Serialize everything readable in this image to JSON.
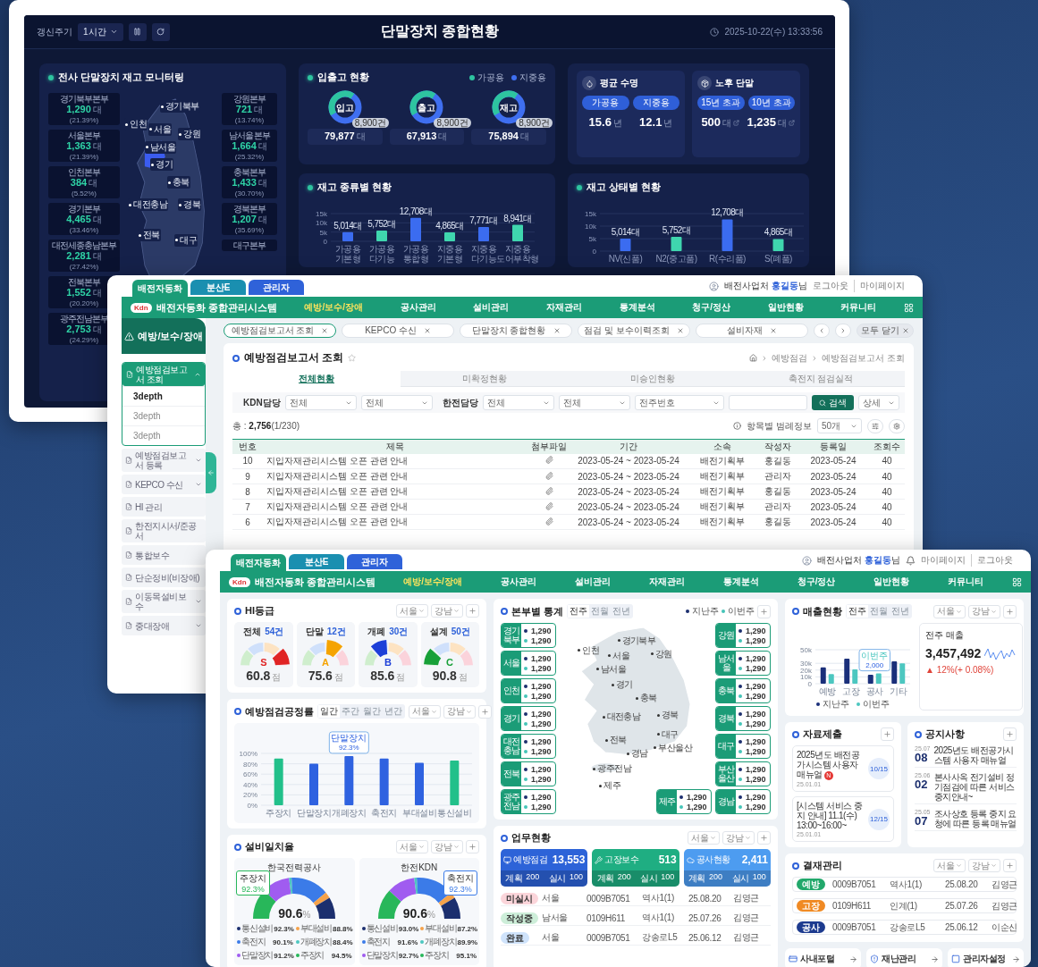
{
  "dashboard_window": {
    "refresh_label": "갱신주기",
    "refresh_interval": "1시간",
    "title": "단말장치 종합현황",
    "datetime": "2025-10-22(수) 13:33:56",
    "inventory_monitor": {
      "title": "전사 단말장치 재고 모니터링",
      "left_offices": [
        {
          "name": "경기북부본부",
          "value": "1,290",
          "unit": "대",
          "share": "(21.39%)"
        },
        {
          "name": "서울본부",
          "value": "1,363",
          "unit": "대",
          "share": "(21.39%)"
        },
        {
          "name": "인천본부",
          "value": "384",
          "unit": "대",
          "share": "(5.52%)"
        },
        {
          "name": "경기본부",
          "value": "4,465",
          "unit": "대",
          "share": "(33.46%)"
        },
        {
          "name": "대전세종충남본부",
          "value": "2,281",
          "unit": "대",
          "share": "(27.42%)"
        },
        {
          "name": "전북본부",
          "value": "1,552",
          "unit": "대",
          "share": "(20.20%)"
        },
        {
          "name": "광주전남본부",
          "value": "2,753",
          "unit": "대",
          "share": "(24.29%)"
        }
      ],
      "right_offices": [
        {
          "name": "강원본부",
          "value": "721",
          "unit": "대",
          "share": "(13.74%)"
        },
        {
          "name": "남서울본부",
          "value": "1,664",
          "unit": "대",
          "share": "(25.32%)"
        },
        {
          "name": "충북본부",
          "value": "1,433",
          "unit": "대",
          "share": "(30.70%)"
        },
        {
          "name": "경북본부",
          "value": "1,207",
          "unit": "대",
          "share": "(35.69%)"
        },
        {
          "name": "대구본부"
        }
      ],
      "map_labels": [
        "경기북부",
        "인천",
        "서울",
        "남서울",
        "경기",
        "강원",
        "충북",
        "대전충남",
        "경북",
        "전북",
        "대구"
      ]
    },
    "in_out": {
      "title": "입출고 현황",
      "legend": [
        {
          "label": "가공용",
          "color": "#2ec4a0"
        },
        {
          "label": "지중용",
          "color": "#3f6ff0"
        }
      ],
      "donuts": [
        {
          "label": "입고",
          "badge": "8,900건",
          "total": "79,877",
          "unit": "대"
        },
        {
          "label": "출고",
          "badge": "8,900건",
          "total": "67,913",
          "unit": "대"
        },
        {
          "label": "재고",
          "badge": "8,900건",
          "total": "75,894",
          "unit": "대"
        }
      ]
    },
    "average_life": {
      "title": "평균 수명",
      "items": [
        {
          "tag": "가공용",
          "value": "15.6",
          "unit": "년"
        },
        {
          "tag": "지중용",
          "value": "12.1",
          "unit": "년"
        }
      ]
    },
    "old_terminals": {
      "title": "노후 단말",
      "items": [
        {
          "tag": "15년 초과",
          "value": "500",
          "unit": "대"
        },
        {
          "tag": "10년 초과",
          "value": "1,235",
          "unit": "대"
        }
      ]
    },
    "type_chart": {
      "title": "재고 종류별 현황",
      "chart_data": {
        "type": "bar",
        "categories": [
          "가공용 기본형",
          "가공용 다기능",
          "가공용 통합형",
          "지중용 기본형",
          "지중용 다기능",
          "지중용 도어부착형"
        ],
        "series": [
          {
            "color": "#3b6cf0",
            "values": [
              5014,
              null,
              12708,
              null,
              7771,
              null
            ]
          },
          {
            "color": "#3fd6ae",
            "values": [
              null,
              5752,
              null,
              4865,
              null,
              8941
            ]
          }
        ],
        "ylim": [
          0,
          15000
        ],
        "grid": true,
        "yticks": [
          {
            "value": 0,
            "label": "0"
          },
          {
            "value": 5000,
            "label": "5k"
          },
          {
            "value": 10000,
            "label": "10k"
          },
          {
            "value": 15000,
            "label": "15k"
          }
        ],
        "value_labels": [
          "5,014대",
          "5,752대",
          "12,708대",
          "4,865대",
          "7,771대",
          "8,941대"
        ]
      }
    },
    "state_chart": {
      "title": "재고 상태별 현황",
      "chart_data": {
        "type": "bar",
        "categories": [
          "NV(신품)",
          "N2(중고품)",
          "R(수리품)",
          "S(폐품)"
        ],
        "series": [
          {
            "color": "#3b6cf0",
            "values": [
              5014,
              null,
              12708,
              null
            ]
          },
          {
            "color": "#3fd6ae",
            "values": [
              null,
              5752,
              null,
              4865
            ]
          }
        ],
        "ylim": [
          0,
          15000
        ],
        "grid": true,
        "yticks": [
          {
            "value": 0,
            "label": "0"
          },
          {
            "value": 5000,
            "label": "5k"
          },
          {
            "value": 10000,
            "label": "10k"
          },
          {
            "value": 15000,
            "label": "15k"
          }
        ],
        "value_labels": [
          "5,014대",
          "5,752대",
          "12,708대",
          "4,865대"
        ]
      }
    }
  },
  "report_window": {
    "system_tabs": [
      {
        "label": "배전자동화",
        "selected": true,
        "color": "#1b9c77"
      },
      {
        "label": "분산E",
        "selected": false,
        "color": "#1a8fb0"
      },
      {
        "label": "관리자",
        "selected": false,
        "color": "#2f62d9"
      }
    ],
    "user": "배전사업처 **홍길동**님",
    "links": [
      "로그아웃",
      "마이페이지"
    ],
    "brand": {
      "logo": "Kdn",
      "name": "배전자동화 종합관리시스템"
    },
    "menu": [
      {
        "label": "예방/보수/장애",
        "selected": true
      },
      {
        "label": "공사관리",
        "selected": false
      },
      {
        "label": "설비관리",
        "selected": false
      },
      {
        "label": "자재관리",
        "selected": false
      },
      {
        "label": "통계분석",
        "selected": false
      },
      {
        "label": "청구/정산",
        "selected": false
      },
      {
        "label": "일반현황",
        "selected": false
      },
      {
        "label": "커뮤니티",
        "selected": false
      }
    ],
    "sidebar": {
      "title": "예방/보수/장애",
      "items": [
        {
          "label": "예방점검보고서 조회",
          "expandable": true,
          "expanded": true,
          "selected": true,
          "children": [
            {
              "label": "3depth",
              "selected": true
            },
            {
              "label": "3depth",
              "selected": false
            },
            {
              "label": "3depth",
              "selected": false
            }
          ]
        },
        {
          "label": "예방점검보고서 등록",
          "expandable": true,
          "expanded": false,
          "selected": false
        },
        {
          "label": "KEPCO 수신",
          "expandable": true,
          "expanded": false,
          "selected": false
        },
        {
          "label": "HI 관리",
          "expandable": false,
          "expanded": false,
          "selected": false
        },
        {
          "label": "한전지시서/준공서",
          "expandable": false,
          "expanded": false,
          "selected": false
        },
        {
          "label": "통합보수",
          "expandable": false,
          "expanded": false,
          "selected": false
        },
        {
          "label": "단순정비(비장애)",
          "expandable": false,
          "expanded": false,
          "selected": false
        },
        {
          "label": "이동목설비보수",
          "expandable": true,
          "expanded": false,
          "selected": false
        },
        {
          "label": "중대장애",
          "expandable": true,
          "expanded": false,
          "selected": false
        }
      ]
    },
    "page_tabs": [
      {
        "label": "예방점검보고서 조회",
        "selected": true
      },
      {
        "label": "KEPCO 수신",
        "selected": false
      },
      {
        "label": "단말장치 종합현황",
        "selected": false
      },
      {
        "label": "점검 및 보수이력조회",
        "selected": false
      },
      {
        "label": "설비자재",
        "selected": false
      }
    ],
    "close_all": "모두 닫기",
    "page_title": "예방점검보고서 조회",
    "breadcrumb": [
      "예방점검",
      "예방점검보고서 조회"
    ],
    "sub_tabs": [
      {
        "label": "전체현황",
        "selected": true
      },
      {
        "label": "미확정현황",
        "selected": false
      },
      {
        "label": "미승인현황",
        "selected": false
      },
      {
        "label": "축전지 점검실적",
        "selected": false
      }
    ],
    "filters": [
      {
        "label": "KDN담당",
        "selects": [
          "전체",
          "전체"
        ]
      },
      {
        "label": "한전담당",
        "selects": [
          "전체",
          "전체",
          "전주번호"
        ]
      }
    ],
    "search_button": "검색",
    "detail_button": "상세",
    "total": "총 : **2,756**(1/230)",
    "legend_info": "항목별 범례정보",
    "page_size": "50개",
    "table": {
      "columns": [
        "번호",
        "제목",
        "첨부파일",
        "기간",
        "소속",
        "작성자",
        "등록일",
        "조회수"
      ],
      "rows": [
        {
          "cells": [
            "10",
            "지입자재관리시스템 오픈 관련 안내",
            "",
            "2023-05-24 ~ 2023-05-24",
            "배전기획부",
            "홍길동",
            "2023-05-24",
            "40"
          ],
          "attachment": true
        },
        {
          "cells": [
            "9",
            "지입자재관리시스템 오픈 관련 안내",
            "",
            "2023-05-24 ~ 2023-05-24",
            "배전기획부",
            "관리자",
            "2023-05-24",
            "40"
          ],
          "attachment": true
        },
        {
          "cells": [
            "8",
            "지입자재관리시스템 오픈 관련 안내",
            "",
            "2023-05-24 ~ 2023-05-24",
            "배전기획부",
            "홍길동",
            "2023-05-24",
            "40"
          ],
          "attachment": true
        },
        {
          "cells": [
            "7",
            "지입자재관리시스템 오픈 관련 안내",
            "",
            "2023-05-24 ~ 2023-05-24",
            "배전기획부",
            "관리자",
            "2023-05-24",
            "40"
          ],
          "attachment": true
        },
        {
          "cells": [
            "6",
            "지입자재관리시스템 오픈 관련 안내",
            "",
            "2023-05-24 ~ 2023-05-24",
            "배전기획부",
            "홍길동",
            "2023-05-24",
            "40"
          ],
          "attachment": true
        }
      ]
    }
  },
  "main_window": {
    "system_tabs": [
      {
        "label": "배전자동화",
        "selected": true,
        "color": "#1b9c77"
      },
      {
        "label": "분산E",
        "selected": false,
        "color": "#1a8fb0"
      },
      {
        "label": "관리자",
        "selected": false,
        "color": "#2f62d9"
      }
    ],
    "user": "배전사업처 **홍길동**님",
    "links": [
      "마이페이지",
      "로그아웃"
    ],
    "brand": {
      "logo": "Kdn",
      "name": "배전자동화 종합관리시스템"
    },
    "menu": [
      {
        "label": "예방/보수/장애",
        "selected": true
      },
      {
        "label": "공사관리",
        "selected": false
      },
      {
        "label": "설비관리",
        "selected": false
      },
      {
        "label": "자재관리",
        "selected": false
      },
      {
        "label": "통계분석",
        "selected": false
      },
      {
        "label": "청구/정산",
        "selected": false
      },
      {
        "label": "일반현황",
        "selected": false
      },
      {
        "label": "커뮤니티",
        "selected": false
      }
    ],
    "hi_grade": {
      "title": "HI등급",
      "filters": [
        "서울",
        "강남"
      ],
      "cards": [
        {
          "label": "전체",
          "count": "54건",
          "grade": "S",
          "kind": "s",
          "color": "#e02424",
          "score": "60.8",
          "unit": "점"
        },
        {
          "label": "단말",
          "count": "12건",
          "grade": "A",
          "kind": "a",
          "color": "#f5a300",
          "score": "75.6",
          "unit": "점"
        },
        {
          "label": "개폐",
          "count": "30건",
          "grade": "B",
          "kind": "b",
          "color": "#1d3fd8",
          "score": "85.6",
          "unit": "점"
        },
        {
          "label": "설계",
          "count": "50건",
          "grade": "C",
          "kind": "c",
          "color": "#18a038",
          "score": "90.8",
          "unit": "점"
        }
      ]
    },
    "progress": {
      "title": "예방점검공정률",
      "periods": [
        {
          "label": "일간",
          "selected": true
        },
        {
          "label": "주간",
          "selected": false
        },
        {
          "label": "월간",
          "selected": false
        },
        {
          "label": "년간",
          "selected": false
        }
      ],
      "filters": [
        "서울",
        "강남"
      ],
      "chart_data": {
        "type": "bar",
        "categories": [
          "주장치",
          "단말장치",
          "개폐장치",
          "축전지",
          "부대설비",
          "통신설비"
        ],
        "series": [
          {
            "color": "#22c08a",
            "values": [
              90,
              null,
              null,
              null,
              null,
              86
            ]
          },
          {
            "color": "#2f62e0",
            "values": [
              null,
              80,
              95,
              90,
              82,
              null
            ]
          }
        ],
        "ylim": [
          0,
          100
        ],
        "grid": true,
        "yticks": [
          {
            "value": 0,
            "label": "0%"
          },
          {
            "value": 20,
            "label": "20%"
          },
          {
            "value": 40,
            "label": "40%"
          },
          {
            "value": 60,
            "label": "60%"
          },
          {
            "value": 80,
            "label": "80%"
          },
          {
            "value": 100,
            "label": "100%"
          }
        ],
        "annotations": [
          {
            "x": "개폐장치",
            "y": 95,
            "text": "92.3%"
          }
        ]
      },
      "tooltip_title": "단말장치"
    },
    "match_rate": {
      "title": "설비일치율",
      "filters": [
        "서울",
        "강남"
      ],
      "cards": [
        {
          "org": "한국전력공사",
          "value": "90.6",
          "unit": "%",
          "tooltip": {
            "label": "주장치",
            "value": "92.3%",
            "color": "#28b75a"
          },
          "legend": [
            {
              "label": "통신설비",
              "value": "92.3%",
              "color": "#1c2f6e"
            },
            {
              "label": "부대설비",
              "value": "88.8%",
              "color": "#f5a24a"
            },
            {
              "label": "축전지",
              "value": "90.1%",
              "color": "#3b7be8"
            },
            {
              "label": "개폐장치",
              "value": "88.4%",
              "color": "#4cc7c0"
            },
            {
              "label": "단말장치",
              "value": "91.2%",
              "color": "#a05cf0"
            },
            {
              "label": "주장치",
              "value": "94.5%",
              "color": "#28b75a"
            }
          ]
        },
        {
          "org": "한전KDN",
          "value": "90.6",
          "unit": "%",
          "tooltip": {
            "label": "축전지",
            "value": "92.3%",
            "color": "#3b7be8"
          },
          "legend": [
            {
              "label": "통신설비",
              "value": "93.0%",
              "color": "#1c2f6e"
            },
            {
              "label": "부대설비",
              "value": "87.2%",
              "color": "#f5a24a"
            },
            {
              "label": "축전지",
              "value": "91.6%",
              "color": "#3b7be8"
            },
            {
              "label": "개폐장치",
              "value": "89.9%",
              "color": "#4cc7c0"
            },
            {
              "label": "단말장치",
              "value": "92.7%",
              "color": "#a05cf0"
            },
            {
              "label": "주장치",
              "value": "95.1%",
              "color": "#28b75a"
            }
          ]
        }
      ]
    },
    "regional": {
      "title": "본부별 통계",
      "periods": [
        {
          "label": "전주",
          "selected": true
        },
        {
          "label": "전월",
          "selected": false
        },
        {
          "label": "전년",
          "selected": false
        }
      ],
      "legend": [
        {
          "label": "지난주",
          "color": "#1c2f6e"
        },
        {
          "label": "이번주",
          "color": "#45c4b8"
        }
      ],
      "left": [
        {
          "name": "경기북부",
          "values": [
            "1,290",
            "1,290"
          ]
        },
        {
          "name": "서울",
          "values": [
            "1,290",
            "1,290"
          ]
        },
        {
          "name": "인천",
          "values": [
            "1,290",
            "1,290"
          ]
        },
        {
          "name": "경기",
          "values": [
            "1,290",
            "1,290"
          ]
        },
        {
          "name": "대전충남",
          "values": [
            "1,290",
            "1,290"
          ]
        },
        {
          "name": "전북",
          "values": [
            "1,290",
            "1,290"
          ]
        },
        {
          "name": "광주전남",
          "values": [
            "1,290",
            "1,290"
          ]
        }
      ],
      "right": [
        {
          "name": "강원",
          "values": [
            "1,290",
            "1,290"
          ]
        },
        {
          "name": "남서울",
          "values": [
            "1,290",
            "1,290"
          ]
        },
        {
          "name": "충북",
          "values": [
            "1,290",
            "1,290"
          ]
        },
        {
          "name": "경북",
          "values": [
            "1,290",
            "1,290"
          ]
        },
        {
          "name": "대구",
          "values": [
            "1,290",
            "1,290"
          ]
        },
        {
          "name": "부산울산",
          "values": [
            "1,290",
            "1,290"
          ]
        },
        {
          "name": "경남",
          "values": [
            "1,290",
            "1,290"
          ]
        }
      ],
      "bottom": [
        {
          "name": "제주",
          "values": [
            "1,290",
            "1,290"
          ]
        }
      ],
      "map_labels": [
        "경기북부",
        "인천",
        "서울",
        "남서울",
        "경기",
        "강원",
        "충북",
        "대전충남",
        "경북",
        "전북",
        "대구",
        "부산울산",
        "경남",
        "광주전남",
        "제주"
      ]
    },
    "work_status": {
      "title": "업무현황",
      "filters": [
        "서울",
        "강남"
      ],
      "cards": [
        {
          "label": "예방점검",
          "value": "13,553",
          "plan_label": "계획",
          "plan": "200",
          "done_label": "실시",
          "done": "100",
          "color": "#2d63d8"
        },
        {
          "label": "고장보수",
          "value": "513",
          "plan_label": "계획",
          "plan": "200",
          "done_label": "실시",
          "done": "100",
          "color": "#1fae82"
        },
        {
          "label": "공사현황",
          "value": "2,411",
          "plan_label": "계획",
          "plan": "200",
          "done_label": "실시",
          "done": "100",
          "color": "#4d9cf0"
        }
      ],
      "rows": [
        {
          "status": "미실시",
          "color": "#fbd5da",
          "cells": [
            "서울",
            "0009B7051",
            "역사1(1)",
            "25.08.20",
            "김영근"
          ]
        },
        {
          "status": "작성중",
          "color": "#cdeed9",
          "cells": [
            "남서울",
            "0109H611",
            "역사1(1)",
            "25.07.26",
            "김영근"
          ]
        },
        {
          "status": "완료",
          "color": "#cfe3fb",
          "cells": [
            "서울",
            "0009B7051",
            "강송로L5",
            "25.06.12",
            "김영근"
          ]
        }
      ]
    },
    "sales": {
      "title": "매출현황",
      "periods": [
        {
          "label": "전주",
          "selected": true
        },
        {
          "label": "전월",
          "selected": false
        },
        {
          "label": "전년",
          "selected": false
        }
      ],
      "filters": [
        "서울",
        "강남"
      ],
      "chart_data": {
        "type": "bar",
        "categories": [
          "예방",
          "고장",
          "공사",
          "기타"
        ],
        "series": [
          {
            "name": "지난주",
            "color": "#1a2f7a",
            "values": [
              24000,
              37000,
              13000,
              33000
            ]
          },
          {
            "name": "이번주",
            "color": "#4cc7c0",
            "values": [
              14000,
              21000,
              15000,
              30000
            ]
          }
        ],
        "ylim": [
          0,
          50000
        ],
        "grid": true,
        "yticks": [
          {
            "value": 0,
            "label": "0"
          },
          {
            "value": 10000,
            "label": "10k"
          },
          {
            "value": 20000,
            "label": "20k"
          },
          {
            "value": 30000,
            "label": "30k"
          },
          {
            "value": 50000,
            "label": "50k"
          }
        ],
        "annotations": [
          {
            "x": "공사",
            "y": 15000,
            "text": "2,000"
          }
        ]
      },
      "tooltip_title": "이번주",
      "summary": {
        "label": "전주 매출",
        "value": "3,457,492",
        "change": "▲ 12%(+ 0.08%)"
      }
    },
    "submissions": {
      "title": "자료제출",
      "items": [
        {
          "title": "2025년도 배전공가시스템 사용자 매뉴얼",
          "is_new": true,
          "new_badge": "N",
          "date": "25.01.01",
          "count": "10/15"
        },
        {
          "title": "[시스템 서비스 중지 안내] 11.1(수) 13:00~16:00~",
          "is_new": false,
          "date": "25.01.01",
          "count": "12/15"
        }
      ]
    },
    "notices": {
      "title": "공지사항",
      "items": [
        {
          "month": "25.07",
          "day": "08",
          "text": "2025년도 배전공가시스템 사용자 매뉴얼"
        },
        {
          "month": "25.06",
          "day": "02",
          "text": "본사사옥 전기설비 정기점검에 따른 서비스 중지안내~"
        },
        {
          "month": "25.05",
          "day": "07",
          "text": "조사상호 등록 중지 요청에 따른 등록 매뉴얼"
        }
      ]
    },
    "approvals": {
      "title": "결재관리",
      "filters": [
        "서울",
        "강남"
      ],
      "rows": [
        {
          "tag": "예방",
          "color": "#22a86b",
          "cells": [
            "0009B7051",
            "역사1(1)",
            "25.08.20",
            "김영근"
          ]
        },
        {
          "tag": "고장",
          "color": "#f08a24",
          "cells": [
            "0109H611",
            "인계(1)",
            "25.07.26",
            "김영근"
          ]
        },
        {
          "tag": "공사",
          "color": "#1d3b8f",
          "cells": [
            "0009B7051",
            "강송로L5",
            "25.06.12",
            "이순신"
          ]
        }
      ]
    },
    "quick_links": [
      {
        "label": "사내포털"
      },
      {
        "label": "재난관리"
      },
      {
        "label": "관리자설정"
      }
    ]
  }
}
